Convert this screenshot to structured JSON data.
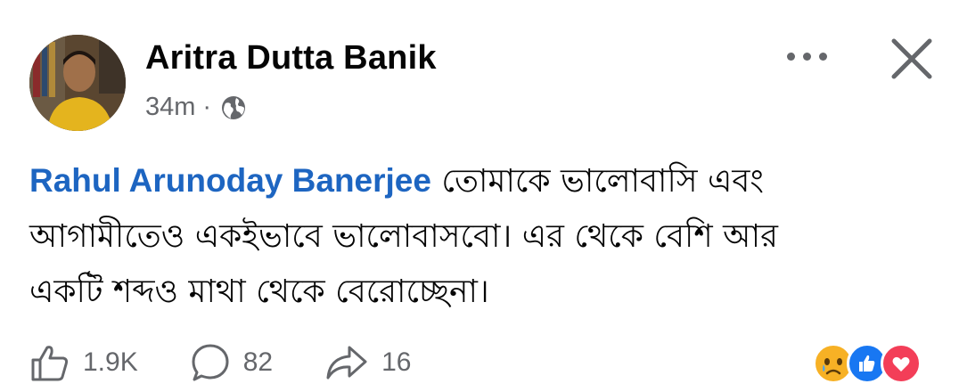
{
  "post": {
    "author": "Aritra Dutta Banik",
    "timestamp": "34m",
    "separator": "·",
    "audience_icon": "globe-icon",
    "mention": "Rahul Arunoday Banerjee",
    "text_line1": " তোমাকে ভালোবাসি এবং",
    "text_line2": "আগামীতেও একইভাবে ভালোবাসবো। এর থেকে বেশি আর",
    "text_line3": "একটি শব্দও মাথা থেকে বেরোচ্ছেনা।"
  },
  "header_actions": {
    "more_icon": "more-dots-icon",
    "close_icon": "close-icon"
  },
  "actions": {
    "like_count": "1.9K",
    "comment_count": "82",
    "share_count": "16"
  },
  "reactions": [
    "sad",
    "like",
    "love"
  ],
  "colors": {
    "mention": "#1d65c1",
    "like": "#1877f2",
    "love": "#f33e58",
    "sad": "#f7b125"
  }
}
